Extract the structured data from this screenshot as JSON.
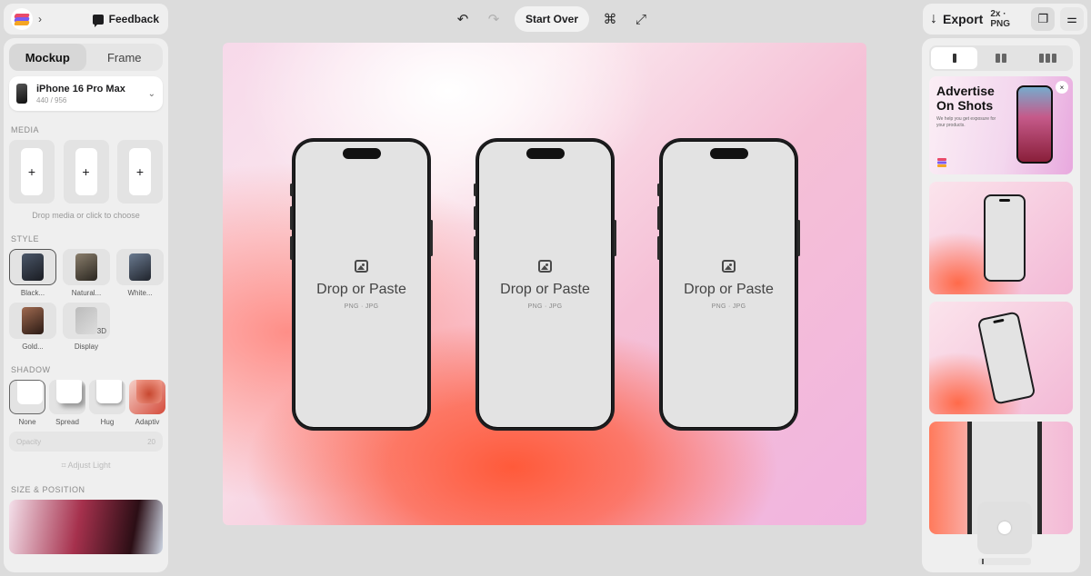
{
  "topbar": {
    "feedback_label": "Feedback",
    "start_over_label": "Start Over",
    "export_label": "Export",
    "export_meta": "2x · PNG"
  },
  "left_panel": {
    "tabs": [
      {
        "label": "Mockup"
      },
      {
        "label": "Frame"
      }
    ],
    "device": {
      "name": "iPhone 16 Pro Max",
      "resolution": "440 / 956"
    },
    "media_section": "MEDIA",
    "media_slot_symbol": "+",
    "media_hint": "Drop media or click to choose",
    "style_section": "STYLE",
    "styles": [
      {
        "label": "Black...",
        "color": "#2a2a2e"
      },
      {
        "label": "Natural...",
        "color": "#6e665c"
      },
      {
        "label": "White...",
        "color": "#3a3e48"
      },
      {
        "label": "Gold...",
        "color": "#6b4a3a"
      },
      {
        "label": "Display",
        "badge": "3D"
      }
    ],
    "shadow_section": "SHADOW",
    "shadows": [
      {
        "label": "None"
      },
      {
        "label": "Spread"
      },
      {
        "label": "Hug"
      },
      {
        "label": "Adaptiv"
      }
    ],
    "opacity_label": "Opacity",
    "opacity_value": "20",
    "adjust_light_label": "Adjust Light",
    "size_section": "SIZE & POSITION"
  },
  "canvas": {
    "phones": [
      {
        "drop_label": "Drop or Paste",
        "formats": "PNG · JPG"
      },
      {
        "drop_label": "Drop or Paste",
        "formats": "PNG · JPG"
      },
      {
        "drop_label": "Drop or Paste",
        "formats": "PNG · JPG"
      }
    ]
  },
  "right_panel": {
    "ad": {
      "title": "Advertise On Shots",
      "subtitle": "We help you get exposure for your products.",
      "close_symbol": "×"
    }
  },
  "colors": {
    "accent_coral": "#ff5a3a",
    "accent_pink": "#f1b4e0"
  }
}
